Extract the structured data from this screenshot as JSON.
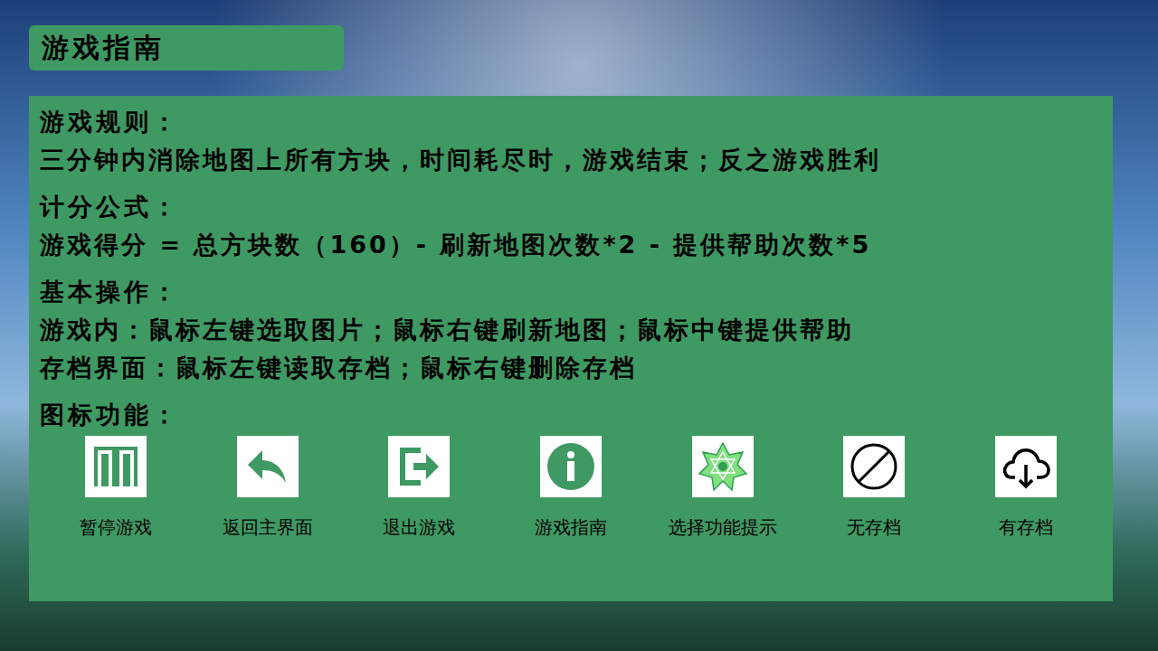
{
  "title": "游戏指南",
  "sections": [
    {
      "heading": "游戏规则：",
      "lines": [
        "三分钟内消除地图上所有方块，时间耗尽时，游戏结束；反之游戏胜利"
      ]
    },
    {
      "heading": "计分公式：",
      "lines": [
        "游戏得分 = 总方块数（160）- 刷新地图次数*2 - 提供帮助次数*5"
      ]
    },
    {
      "heading": "基本操作：",
      "lines": [
        "游戏内：鼠标左键选取图片；鼠标右键刷新地图；鼠标中键提供帮助",
        "存档界面：鼠标左键读取存档；鼠标右键删除存档"
      ]
    }
  ],
  "icons_heading": "图标功能：",
  "icons": [
    {
      "label": "暂停游戏",
      "kind": "pause"
    },
    {
      "label": "返回主界面",
      "kind": "back"
    },
    {
      "label": "退出游戏",
      "kind": "exit"
    },
    {
      "label": "游戏指南",
      "kind": "info"
    },
    {
      "label": "选择功能提示",
      "kind": "flower"
    },
    {
      "label": "无存档",
      "kind": "none"
    },
    {
      "label": "有存档",
      "kind": "cloud"
    }
  ]
}
